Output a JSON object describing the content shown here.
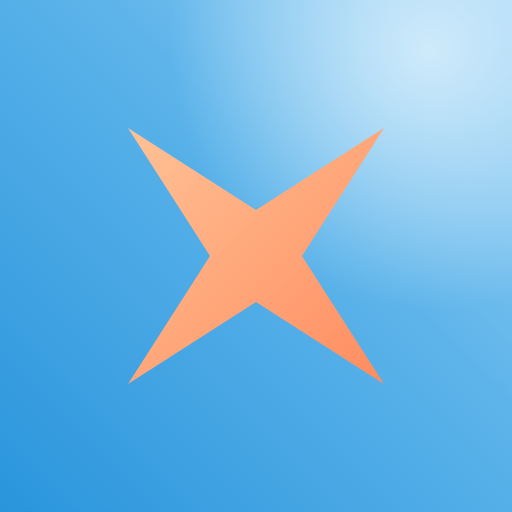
{
  "icon": {
    "name": "four-point-star-icon",
    "colors": {
      "background_base": "#2a95dc",
      "background_mid": "#5db4ea",
      "background_highlight": "#d2ecfb",
      "star_light": "#ffc296",
      "star_dark": "#ff8c5f"
    }
  }
}
